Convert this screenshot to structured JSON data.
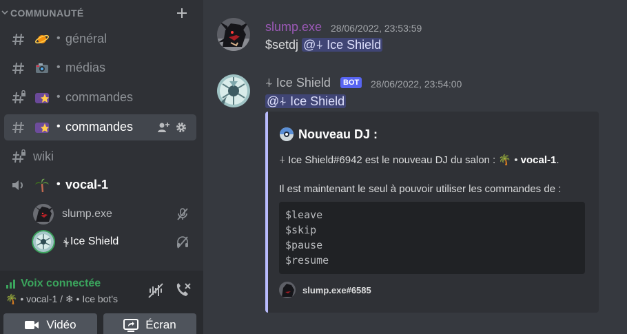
{
  "sidebar": {
    "category": "COMMUNAUTÉ",
    "channels": [
      {
        "name": "général",
        "emoji": "planet"
      },
      {
        "name": "médias",
        "emoji": "camera"
      },
      {
        "name": "commandes",
        "emoji": "shooting-star"
      },
      {
        "name": "commandes",
        "emoji": "shooting-star",
        "active": true
      },
      {
        "name": "wiki"
      }
    ],
    "voice_channel": {
      "name": "vocal-1",
      "emoji": "palm-tree"
    },
    "voice_users": [
      {
        "name": "slump.exe"
      },
      {
        "name": "Ice Shield"
      }
    ],
    "dot": "•"
  },
  "voice_panel": {
    "status": "Voix connectée",
    "subtitle": "🌴 • vocal-1 / ❄ • Ice bot's",
    "video_label": "Vidéo",
    "screen_label": "Écran"
  },
  "messages": [
    {
      "author": "slump.exe",
      "author_color": "#9b59b6",
      "timestamp": "28/06/2022, 23:53:59",
      "command": "$setdj",
      "mention": "@⍭ Ice Shield"
    },
    {
      "author": "⍭ Ice Shield",
      "bot_tag": "BOT",
      "timestamp": "28/06/2022, 23:54:00",
      "mention": "@⍭ Ice Shield",
      "embed": {
        "title": "Nouveau DJ :",
        "line1_prefix": "⍭ Ice Shield#6942 est le nouveau DJ du salon : 🌴 • ",
        "line1_channel": "vocal-1",
        "line1_suffix": ".",
        "line2": "Il est maintenant le seul à pouvoir utiliser les commandes de :",
        "code": [
          "$leave",
          "$skip",
          "$pause",
          "$resume"
        ],
        "footer": "slump.exe#6585"
      }
    }
  ],
  "colors": {
    "accent": "#5865f2",
    "online": "#3ba55d",
    "embed_border": "#b9bbfd"
  }
}
